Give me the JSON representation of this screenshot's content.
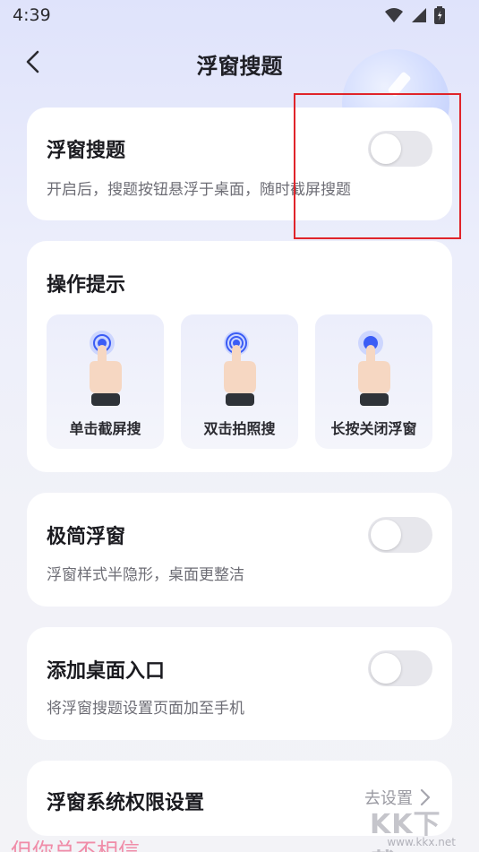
{
  "status_bar": {
    "time": "4:39"
  },
  "header": {
    "title": "浮窗搜题"
  },
  "cards": {
    "float_search": {
      "title": "浮窗搜题",
      "description": "开启后，搜题按钮悬浮于桌面，随时截屏搜题",
      "toggle_on": false
    },
    "tips": {
      "title": "操作提示",
      "items": [
        {
          "label": "单击截屏搜",
          "icon": "tap-hand-icon"
        },
        {
          "label": "双击拍照搜",
          "icon": "double-tap-hand-icon"
        },
        {
          "label": "长按关闭浮窗",
          "icon": "long-press-hand-icon"
        }
      ]
    },
    "minimal": {
      "title": "极简浮窗",
      "description": "浮窗样式半隐形，桌面更整洁",
      "toggle_on": false
    },
    "desktop_entry": {
      "title": "添加桌面入口",
      "description": "将浮窗搜题设置页面加至手机",
      "toggle_on": false
    },
    "permission": {
      "title": "浮窗系统权限设置",
      "link_label": "去设置"
    }
  },
  "overlay_text": "但你总不相信",
  "watermark": {
    "logo": "KK下载",
    "url": "www.kkx.net"
  },
  "colors": {
    "highlight": "#e0242a",
    "toggle_off": "#e7e7ec",
    "accent_blue": "#3b5cf5"
  }
}
